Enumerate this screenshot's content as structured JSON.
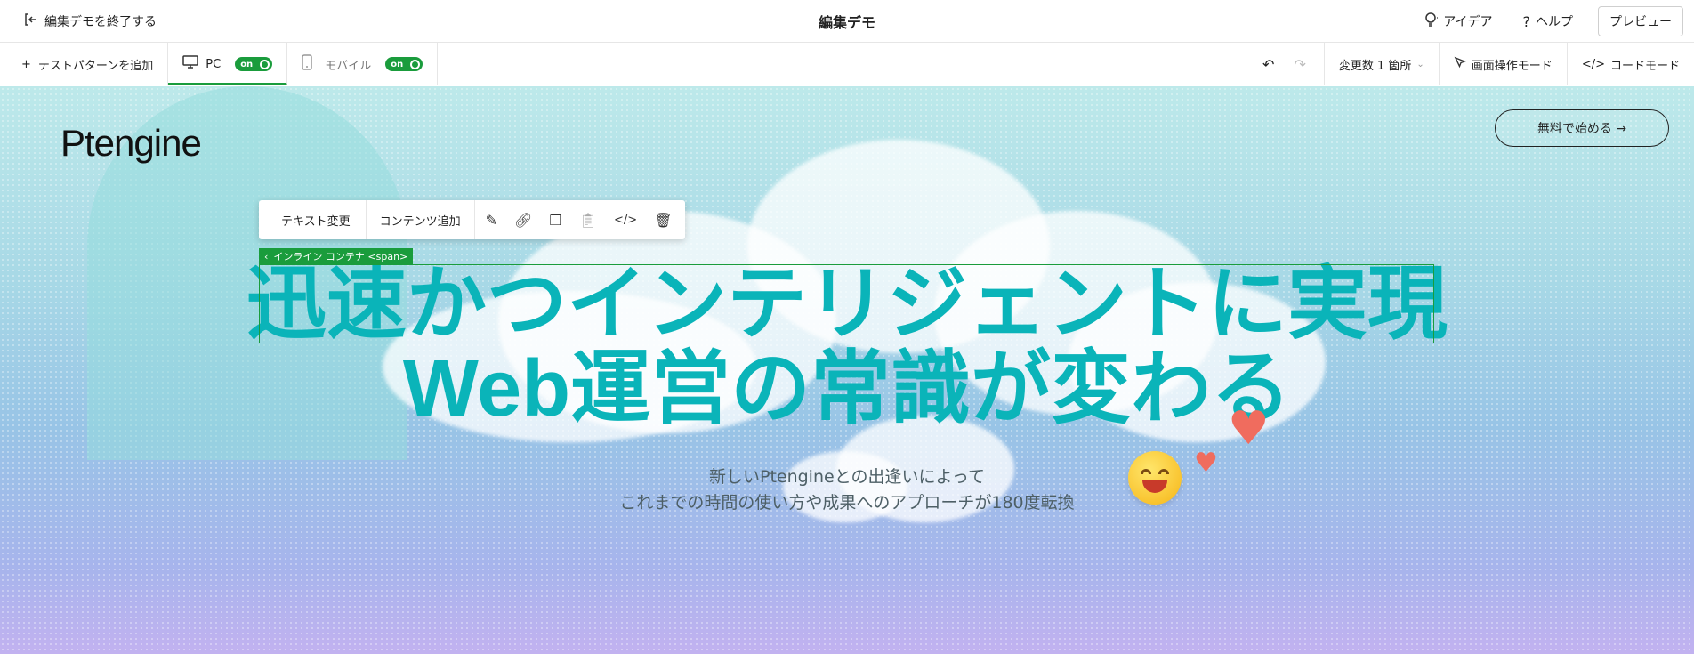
{
  "topbar": {
    "exit_label": "編集デモを終了する",
    "title": "編集デモ",
    "idea_label": "アイデア",
    "help_label": "ヘルプ",
    "preview_label": "プレビュー"
  },
  "toolbar": {
    "add_pattern_label": "テストパターンを追加",
    "pc_label": "PC",
    "pc_toggle": "on",
    "mobile_label": "モバイル",
    "mobile_toggle": "on",
    "changes_label": "変更数 1 箇所",
    "screen_mode_label": "画面操作モード",
    "code_mode_label": "コードモード"
  },
  "page": {
    "logo": "Ptengine",
    "cta_label": "無料で始める →",
    "headline_line1": "迅速かつインテリジェントに実現",
    "headline_line2": "Web運営の常識が変わる",
    "subtitle_line1": "新しいPtengineとの出逢いによって",
    "subtitle_line2": "これまでの時間の使い方や成果へのアプローチが180度転換"
  },
  "editor": {
    "text_change_label": "テキスト変更",
    "add_content_label": "コンテンツ追加",
    "breadcrumb_label": "インライン コンテナ <span>"
  },
  "colors": {
    "accent_green": "#1a9c3c",
    "headline_teal": "#0ab4b9"
  }
}
